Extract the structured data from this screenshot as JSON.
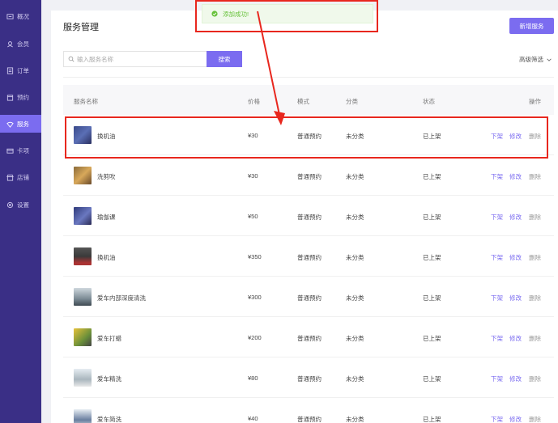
{
  "sidebar": {
    "items": [
      {
        "label": "概况",
        "icon": "overview-icon",
        "active": false
      },
      {
        "label": "会员",
        "icon": "member-icon",
        "active": false
      },
      {
        "label": "订单",
        "icon": "order-icon",
        "active": false
      },
      {
        "label": "预约",
        "icon": "booking-icon",
        "active": false
      },
      {
        "label": "服务",
        "icon": "service-icon",
        "active": true
      },
      {
        "label": "卡项",
        "icon": "card-icon",
        "active": false
      },
      {
        "label": "店铺",
        "icon": "store-icon",
        "active": false
      },
      {
        "label": "设置",
        "icon": "settings-icon",
        "active": false
      }
    ]
  },
  "header": {
    "title": "服务管理",
    "add_label": "新增服务"
  },
  "search": {
    "placeholder": "输入服务名称",
    "button_label": "搜索",
    "advanced_label": "高级筛选"
  },
  "toast": {
    "message": "添加成功!"
  },
  "table": {
    "columns": [
      "服务名称",
      "价格",
      "模式",
      "分类",
      "状态",
      "操作"
    ],
    "actions": {
      "off": "下架",
      "edit": "修改",
      "delete": "删除"
    },
    "rows": [
      {
        "name": "换机油",
        "price": "¥30",
        "mode": "普通预约",
        "category": "未分类",
        "status": "已上架"
      },
      {
        "name": "洗剪吹",
        "price": "¥30",
        "mode": "普通预约",
        "category": "未分类",
        "status": "已上架"
      },
      {
        "name": "瑜伽课",
        "price": "¥50",
        "mode": "普通预约",
        "category": "未分类",
        "status": "已上架"
      },
      {
        "name": "换机油",
        "price": "¥350",
        "mode": "普通预约",
        "category": "未分类",
        "status": "已上架"
      },
      {
        "name": "爱车内部深度清洗",
        "price": "¥300",
        "mode": "普通预约",
        "category": "未分类",
        "status": "已上架"
      },
      {
        "name": "爱车打蜡",
        "price": "¥200",
        "mode": "普通预约",
        "category": "未分类",
        "status": "已上架"
      },
      {
        "name": "爱车精洗",
        "price": "¥80",
        "mode": "普通预约",
        "category": "未分类",
        "status": "已上架"
      },
      {
        "name": "爱车简洗",
        "price": "¥40",
        "mode": "普通预约",
        "category": "未分类",
        "status": "已上架"
      }
    ]
  },
  "colors": {
    "sidebar": "#3a2f86",
    "accent": "#7b6cf0",
    "success": "#67c23a",
    "annotation": "#e8271e"
  }
}
